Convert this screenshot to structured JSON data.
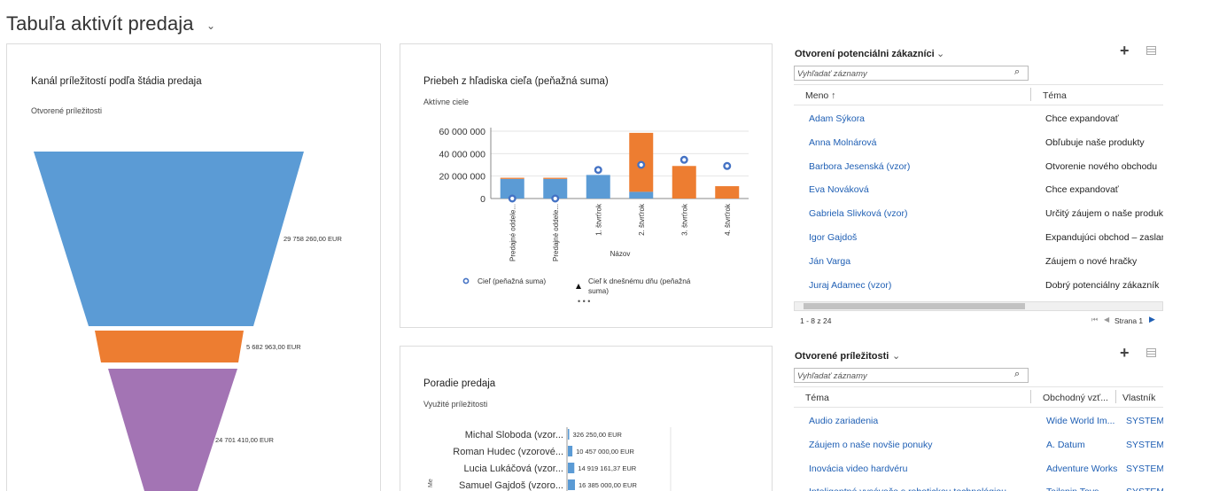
{
  "dashboard": {
    "title": "Tabuľa aktivít predaja"
  },
  "funnel": {
    "title": "Kanál príležitostí podľa štádia predaja",
    "subtitle": "Otvorené príležitosti",
    "colors": [
      "#5b9bd5",
      "#ed7d31",
      "#a374b4"
    ]
  },
  "goal_chart": {
    "title": "Priebeh z hľadiska cieľa (peňažná suma)",
    "subtitle": "Aktívne ciele",
    "legend_goal": "Cieľ (peňažná suma)",
    "legend_today": "Cieľ k dnešnému dňu (peňažná suma)",
    "colors": {
      "actual": "#5b9bd5",
      "remaining": "#ed7d31",
      "marker": "#4472c4"
    }
  },
  "ranking": {
    "title": "Poradie predaja",
    "subtitle": "Využité príležitosti"
  },
  "chart_data": [
    {
      "type": "funnel",
      "title": "Kanál príležitostí podľa štádia predaja",
      "categories": [
        "",
        "",
        ""
      ],
      "values": [
        29758260.0,
        5682963.0,
        24701410.0
      ],
      "labels": [
        "29 758 260,00 EUR",
        "5 682 963,00 EUR",
        "24 701 410,00 EUR"
      ]
    },
    {
      "type": "bar",
      "title": "Priebeh z hľadiska cieľa (peňažná suma)",
      "xlabel": "Názov",
      "ylabel": "",
      "ylim": [
        0,
        60000000
      ],
      "yticks": [
        "60 000 000",
        "40 000 000",
        "20 000 000",
        "0"
      ],
      "categories": [
        "Predajné oddele...",
        "Predajné oddele...",
        "1. štvrťrok",
        "2. štvrťrok",
        "3. štvrťrok",
        "4. štvrťrok"
      ],
      "series": [
        {
          "name": "",
          "values": [
            17500000,
            17500000,
            21000000,
            6000000,
            0,
            0
          ]
        },
        {
          "name": "",
          "values": [
            1000000,
            1000000,
            0,
            52500000,
            29000000,
            11000000
          ]
        },
        {
          "name": "Cieľ (peňažná suma)",
          "values": [
            0,
            0,
            25500000,
            30000000,
            34500000,
            29000000
          ]
        }
      ]
    },
    {
      "type": "bar",
      "title": "Poradie predaja",
      "orientation": "horizontal",
      "categories": [
        "Michal Sloboda (vzor...",
        "Roman Hudec (vzorové...",
        "Lucia Lukáčová (vzor...",
        "Samuel Gajdoš (vzoro..."
      ],
      "values": [
        326250.0,
        10457000.0,
        14919161.37,
        16385000.0
      ],
      "labels": [
        "326 250,00 EUR",
        "10 457 000,00 EUR",
        "14 919 161,37 EUR",
        "16 385 000,00 EUR"
      ]
    }
  ],
  "leads": {
    "title": "Otvorení potenciálni zákazníci",
    "search_placeholder": "Vyhľadať záznamy",
    "col_name": "Meno ↑",
    "col_topic": "Téma",
    "rows": [
      {
        "name": "Adam Sýkora",
        "topic": "Chce expandovať"
      },
      {
        "name": "Anna Molnárová",
        "topic": "Obľubuje naše produkty"
      },
      {
        "name": "Barbora Jesenská (vzor)",
        "topic": "Otvorenie nového obchodu"
      },
      {
        "name": "Eva Nováková",
        "topic": "Chce expandovať"
      },
      {
        "name": "Gabriela Slivková (vzor)",
        "topic": "Určitý záujem o naše produkty"
      },
      {
        "name": "Igor Gajdoš",
        "topic": "Expandujúci obchod – zaslanie"
      },
      {
        "name": "Ján Varga",
        "topic": "Záujem o nové hračky"
      },
      {
        "name": "Juraj Adamec (vzor)",
        "topic": "Dobrý potenciálny zákazník"
      }
    ],
    "record_count": "1 - 8 z 24",
    "page_label": "Strana 1"
  },
  "opportunities": {
    "title": "Otvorené príležitosti",
    "search_placeholder": "Vyhľadať záznamy",
    "col_topic": "Téma",
    "col_account": "Obchodný vzť...",
    "col_owner": "Vlastník",
    "rows": [
      {
        "topic": "Audio zariadenia",
        "account": "Wide World Im...",
        "owner": "SYSTEM"
      },
      {
        "topic": "Záujem o naše novšie ponuky",
        "account": "A. Datum",
        "owner": "SYSTEM"
      },
      {
        "topic": "Inovácia video hardvéru",
        "account": "Adventure Works",
        "owner": "SYSTEM"
      },
      {
        "topic": "Inteligentné vysávače s robotickou technológiou",
        "account": "Tailspin Toys",
        "owner": "SYSTEM"
      }
    ]
  }
}
